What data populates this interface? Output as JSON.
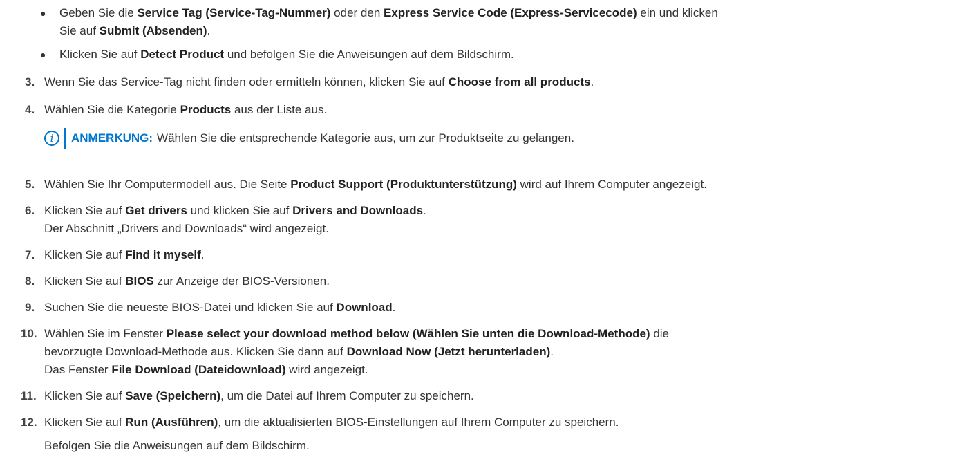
{
  "bullets": [
    {
      "l1": [
        "Geben Sie die ",
        "Service Tag (Service-Tag-Nummer)",
        " oder den ",
        "Express Service Code (Express-Servicecode)",
        " ein und klicken"
      ],
      "l2": [
        "Sie auf ",
        "Submit (Absenden)",
        "."
      ]
    },
    {
      "l1": [
        "Klicken Sie auf ",
        "Detect Product",
        " und befolgen Sie die Anweisungen auf dem Bildschirm."
      ]
    }
  ],
  "steps": {
    "s3": {
      "num": "3.",
      "t": [
        "Wenn Sie das Service-Tag nicht finden oder ermitteln können, klicken Sie auf ",
        "Choose from all products",
        "."
      ]
    },
    "s4": {
      "num": "4.",
      "t": [
        "Wählen Sie die Kategorie ",
        "Products",
        " aus der Liste aus."
      ]
    },
    "s5": {
      "num": "5.",
      "t": [
        "Wählen Sie Ihr Computermodell aus. Die Seite ",
        "Product Support (Produktunterstützung)",
        " wird auf Ihrem Computer angezeigt."
      ]
    },
    "s6": {
      "num": "6.",
      "t": [
        "Klicken Sie auf ",
        "Get drivers",
        " und klicken Sie auf ",
        "Drivers and Downloads",
        "."
      ],
      "sub": "Der Abschnitt „Drivers and Downloads“ wird angezeigt."
    },
    "s7": {
      "num": "7.",
      "t": [
        "Klicken Sie auf ",
        "Find it myself",
        "."
      ]
    },
    "s8": {
      "num": "8.",
      "t": [
        "Klicken Sie auf ",
        "BIOS",
        " zur Anzeige der BIOS-Versionen."
      ]
    },
    "s9": {
      "num": "9.",
      "t": [
        "Suchen Sie die neueste BIOS-Datei und klicken Sie auf ",
        "Download",
        "."
      ]
    },
    "s10": {
      "num": "10.",
      "t": [
        "Wählen Sie im Fenster ",
        "Please select your download method below (Wählen Sie unten die Download-Methode)",
        " die"
      ],
      "t2": [
        "bevorzugte Download-Methode aus. Klicken Sie dann auf ",
        "Download Now (Jetzt herunterladen)",
        "."
      ],
      "t3": [
        "Das Fenster ",
        "File Download (Dateidownload)",
        " wird angezeigt."
      ]
    },
    "s11": {
      "num": "11.",
      "t": [
        "Klicken Sie auf ",
        "Save (Speichern)",
        ", um die Datei auf Ihrem Computer zu speichern."
      ]
    },
    "s12": {
      "num": "12.",
      "t": [
        "Klicken Sie auf ",
        "Run (Ausführen)",
        ", um die aktualisierten BIOS-Einstellungen auf Ihrem Computer zu speichern."
      ],
      "sub": "Befolgen Sie die Anweisungen auf dem Bildschirm."
    }
  },
  "note": {
    "icon": "info-icon",
    "label": "ANMERKUNG:",
    "text": "Wählen Sie die entsprechende Kategorie aus, um zur Produktseite zu gelangen."
  },
  "colors": {
    "accent": "#0076ce",
    "text": "#333333"
  }
}
